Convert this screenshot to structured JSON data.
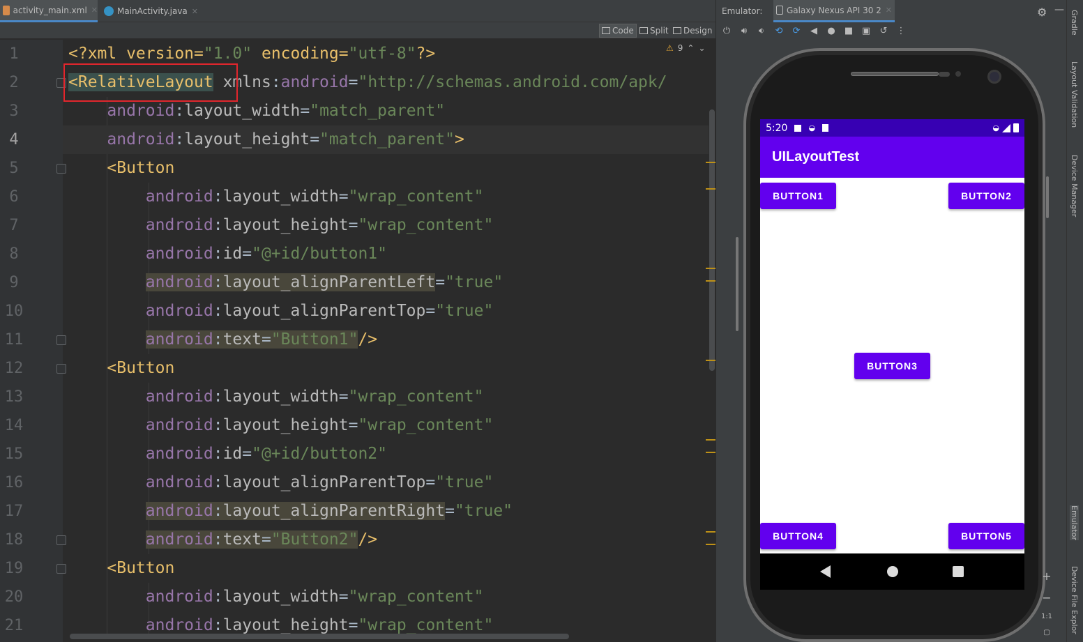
{
  "tabs": [
    {
      "label": "activity_main.xml",
      "active": true
    },
    {
      "label": "MainActivity.java",
      "active": false
    }
  ],
  "view_modes": {
    "code": "Code",
    "split": "Split",
    "design": "Design"
  },
  "warnings": {
    "count": "9"
  },
  "line_numbers": [
    "1",
    "2",
    "3",
    "4",
    "5",
    "6",
    "7",
    "8",
    "9",
    "10",
    "11",
    "12",
    "13",
    "14",
    "15",
    "16",
    "17",
    "18",
    "19",
    "20",
    "21"
  ],
  "code": {
    "l1": {
      "a": "<?xml version=",
      "b": "\"1.0\"",
      "c": " encoding=",
      "d": "\"utf-8\"",
      "e": "?>"
    },
    "l2": {
      "tag": "<RelativeLayout",
      "attr": " xmlns",
      "colon": ":",
      "ns": "android",
      "eq": "=",
      "val": "\"http://schemas.android.com/apk/"
    },
    "l3": {
      "ns": "android",
      "colon": ":",
      "attr": "layout_width",
      "eq": "=",
      "val": "\"match_parent\""
    },
    "l4": {
      "ns": "android",
      "colon": ":",
      "attr": "layout_height",
      "eq": "=",
      "val": "\"match_parent\"",
      "end": ">"
    },
    "l5": {
      "tag": "<Button"
    },
    "l6": {
      "ns": "android",
      "colon": ":",
      "attr": "layout_width",
      "eq": "=",
      "val": "\"wrap_content\""
    },
    "l7": {
      "ns": "android",
      "colon": ":",
      "attr": "layout_height",
      "eq": "=",
      "val": "\"wrap_content\""
    },
    "l8": {
      "ns": "android",
      "colon": ":",
      "attr": "id",
      "eq": "=",
      "val": "\"@+id/button1\""
    },
    "l9": {
      "ns": "android",
      "colon": ":",
      "attr": "layout_alignParentLeft",
      "eq": "=",
      "val": "\"true\""
    },
    "l10": {
      "ns": "android",
      "colon": ":",
      "attr": "layout_alignParentTop",
      "eq": "=",
      "val": "\"true\""
    },
    "l11": {
      "ns": "android",
      "colon": ":",
      "attr": "text",
      "eq": "=",
      "val": "\"Button1\"",
      "end": "/>"
    },
    "l12": {
      "tag": "<Button"
    },
    "l13": {
      "ns": "android",
      "colon": ":",
      "attr": "layout_width",
      "eq": "=",
      "val": "\"wrap_content\""
    },
    "l14": {
      "ns": "android",
      "colon": ":",
      "attr": "layout_height",
      "eq": "=",
      "val": "\"wrap_content\""
    },
    "l15": {
      "ns": "android",
      "colon": ":",
      "attr": "id",
      "eq": "=",
      "val": "\"@+id/button2\""
    },
    "l16": {
      "ns": "android",
      "colon": ":",
      "attr": "layout_alignParentTop",
      "eq": "=",
      "val": "\"true\""
    },
    "l17": {
      "ns": "android",
      "colon": ":",
      "attr": "layout_alignParentRight",
      "eq": "=",
      "val": "\"true\""
    },
    "l18": {
      "ns": "android",
      "colon": ":",
      "attr": "text",
      "eq": "=",
      "val": "\"Button2\"",
      "end": "/>"
    },
    "l19": {
      "tag": "<Button"
    },
    "l20": {
      "ns": "android",
      "colon": ":",
      "attr": "layout_width",
      "eq": "=",
      "val": "\"wrap_content\""
    },
    "l21": {
      "ns": "android",
      "colon": ":",
      "attr": "layout_height",
      "eq": "=",
      "val": "\"wrap_content\""
    }
  },
  "emulator": {
    "label": "Emulator:",
    "device": "Galaxy Nexus API 30 2"
  },
  "phone": {
    "time": "5:20",
    "app_title": "UILayoutTest",
    "buttons": [
      "BUTTON1",
      "BUTTON2",
      "BUTTON3",
      "BUTTON4",
      "BUTTON5"
    ]
  },
  "zoom": {
    "plus": "+",
    "minus": "−",
    "ratio": "1:1"
  },
  "right_strip": [
    "Gradle",
    "Layout Validation",
    "Device Manager",
    "Emulator",
    "Device File Explor"
  ],
  "colors": {
    "accent": "#6200ee",
    "status": "#3700b3",
    "highlight_box": "#e3262d"
  }
}
